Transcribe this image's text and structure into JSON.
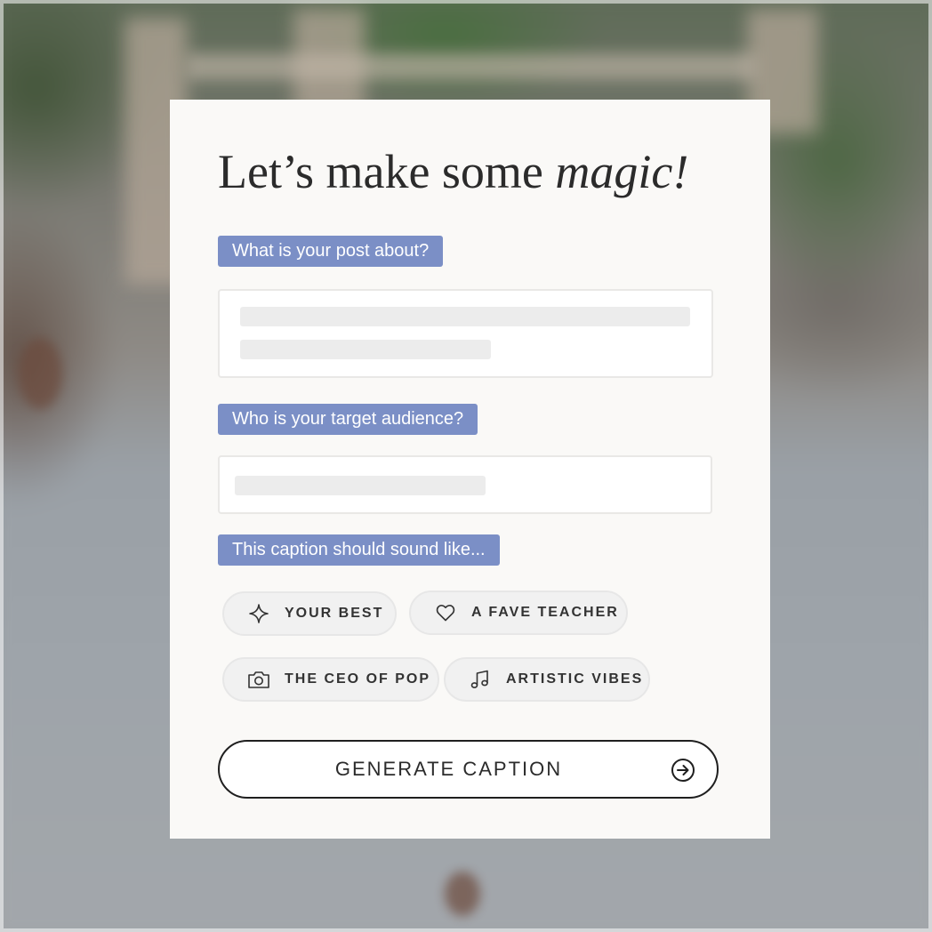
{
  "title": {
    "prefix": "Let’s make some ",
    "emphasis": "magic!"
  },
  "questions": {
    "post_about_label": "What is your post about?",
    "audience_label": "Who is your target audience?",
    "tone_label": "This caption should sound like..."
  },
  "tones": [
    {
      "label": "YOUR BEST",
      "icon": "sparkle-icon"
    },
    {
      "label": "A FAVE TEACHER",
      "icon": "heart-icon"
    },
    {
      "label": "THE CEO OF POP",
      "icon": "camera-icon"
    },
    {
      "label": "ARTISTIC VIBES",
      "icon": "music-note-icon"
    }
  ],
  "actions": {
    "generate_label": "GENERATE CAPTION",
    "generate_icon": "arrow-right-circle-icon"
  },
  "colors": {
    "label_background": "#7b8fc6",
    "card_background": "#faf9f7",
    "chip_background": "#f1f1f1"
  }
}
